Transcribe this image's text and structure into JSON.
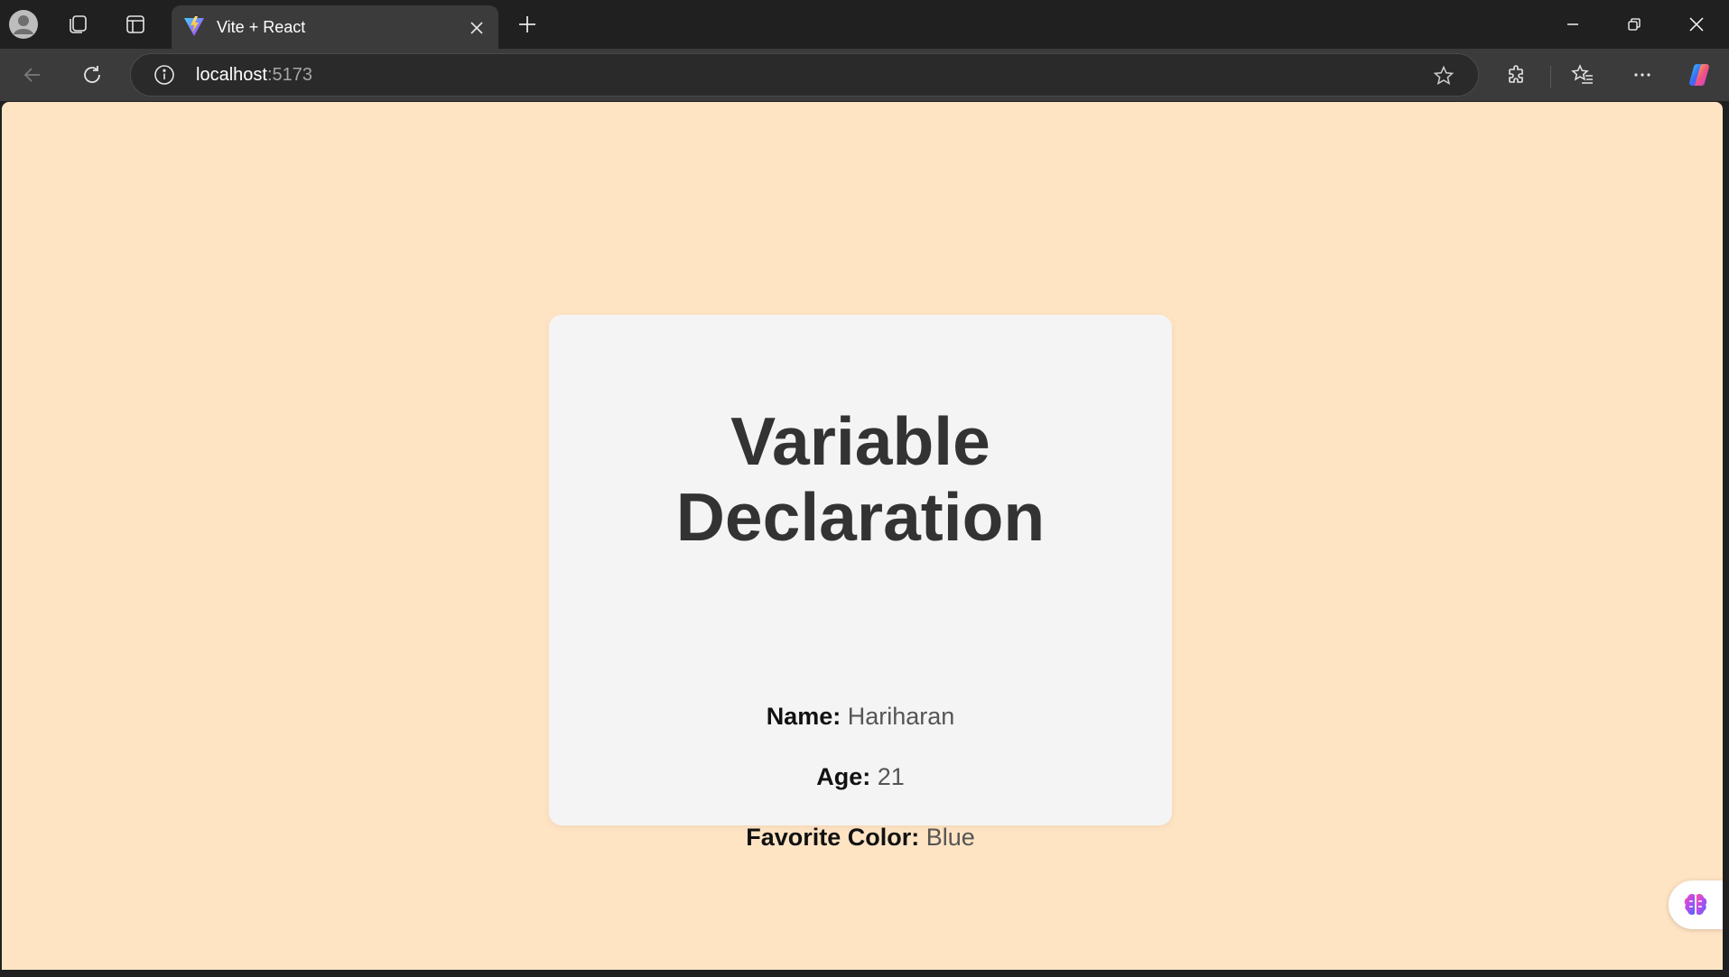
{
  "browser": {
    "tab": {
      "title": "Vite + React"
    },
    "address": {
      "host": "localhost",
      "port": ":5173"
    },
    "colors": {
      "chrome_dark": "#202020",
      "chrome_mid": "#3b3b3b",
      "page_bg": "#ffe4c4"
    }
  },
  "page": {
    "card": {
      "title": "Variable Declaration",
      "rows": [
        {
          "label": "Name:",
          "value": "Hariharan"
        },
        {
          "label": "Age:",
          "value": "21"
        },
        {
          "label": "Favorite Color:",
          "value": "Blue"
        }
      ]
    }
  }
}
